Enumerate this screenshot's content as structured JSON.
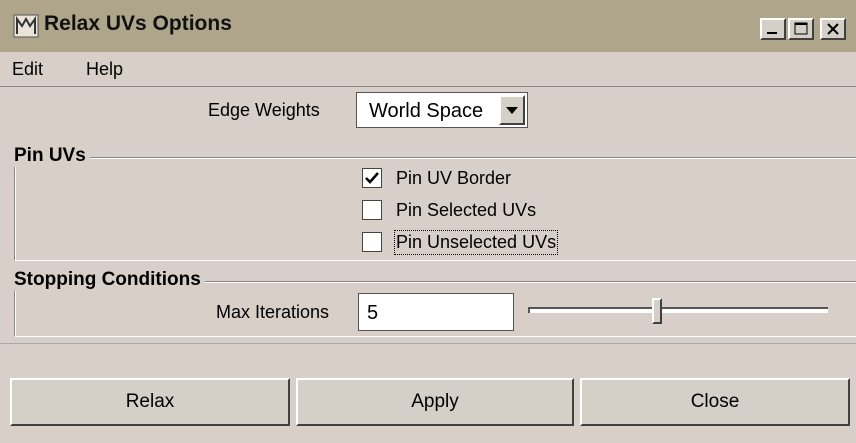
{
  "window": {
    "title": "Relax UVs Options",
    "icon": "maya-logo-icon",
    "controls": [
      "minimize",
      "maximize",
      "close"
    ]
  },
  "menu": [
    "Edit",
    "Help"
  ],
  "edge_weights": {
    "label": "Edge Weights",
    "value": "World Space"
  },
  "pin_uvs": {
    "title": "Pin UVs",
    "options": [
      {
        "label": "Pin UV Border",
        "checked": true
      },
      {
        "label": "Pin Selected UVs",
        "checked": false
      },
      {
        "label": "Pin Unselected UVs",
        "checked": false
      }
    ]
  },
  "stopping": {
    "title": "Stopping Conditions",
    "max_iterations_label": "Max Iterations",
    "max_iterations_value": "5",
    "slider_fraction": 0.43
  },
  "buttons": {
    "relax": "Relax",
    "apply": "Apply",
    "close": "Close"
  }
}
